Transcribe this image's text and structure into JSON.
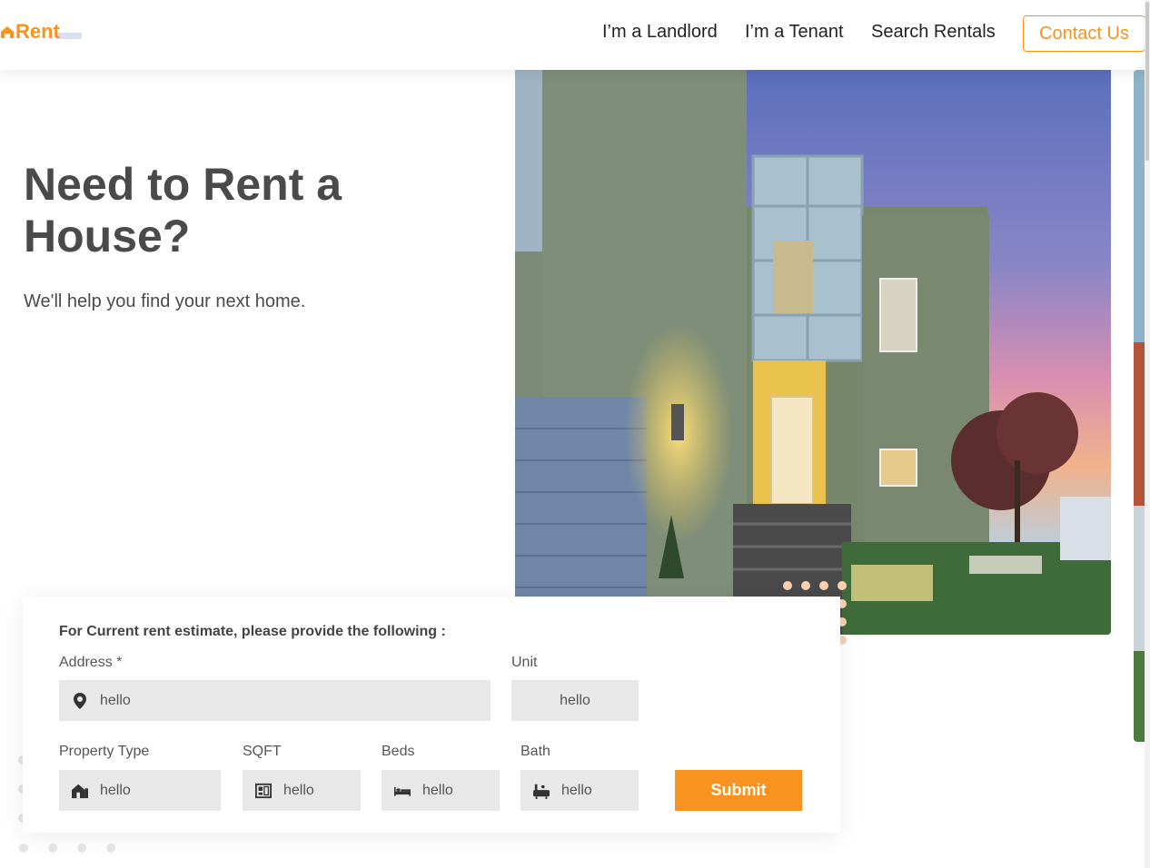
{
  "header": {
    "logo_text": "Rent",
    "nav": {
      "landlord": "I’m a Landlord",
      "tenant": "I’m a Tenant",
      "search": "Search Rentals"
    },
    "contact_label": "Contact Us"
  },
  "hero": {
    "title": "Need to Rent a House?",
    "subtitle": "We'll help you find your next home."
  },
  "form": {
    "heading": "For Current rent estimate, please provide the following :",
    "address": {
      "label": "Address *",
      "placeholder": "hello",
      "icon": "location-pin-icon"
    },
    "unit": {
      "label": "Unit",
      "placeholder": "hello"
    },
    "property_type": {
      "label": "Property Type",
      "placeholder": "hello",
      "icon": "house-icon"
    },
    "sqft": {
      "label": "SQFT",
      "placeholder": "hello",
      "icon": "floorplan-icon"
    },
    "beds": {
      "label": "Beds",
      "placeholder": "hello",
      "icon": "bed-icon"
    },
    "bath": {
      "label": "Bath",
      "placeholder": "hello",
      "icon": "bathtub-icon"
    },
    "submit_label": "Submit"
  },
  "colors": {
    "brand": "#f7931e",
    "text": "#4a4a4a",
    "field_bg": "#e8e8e8"
  }
}
